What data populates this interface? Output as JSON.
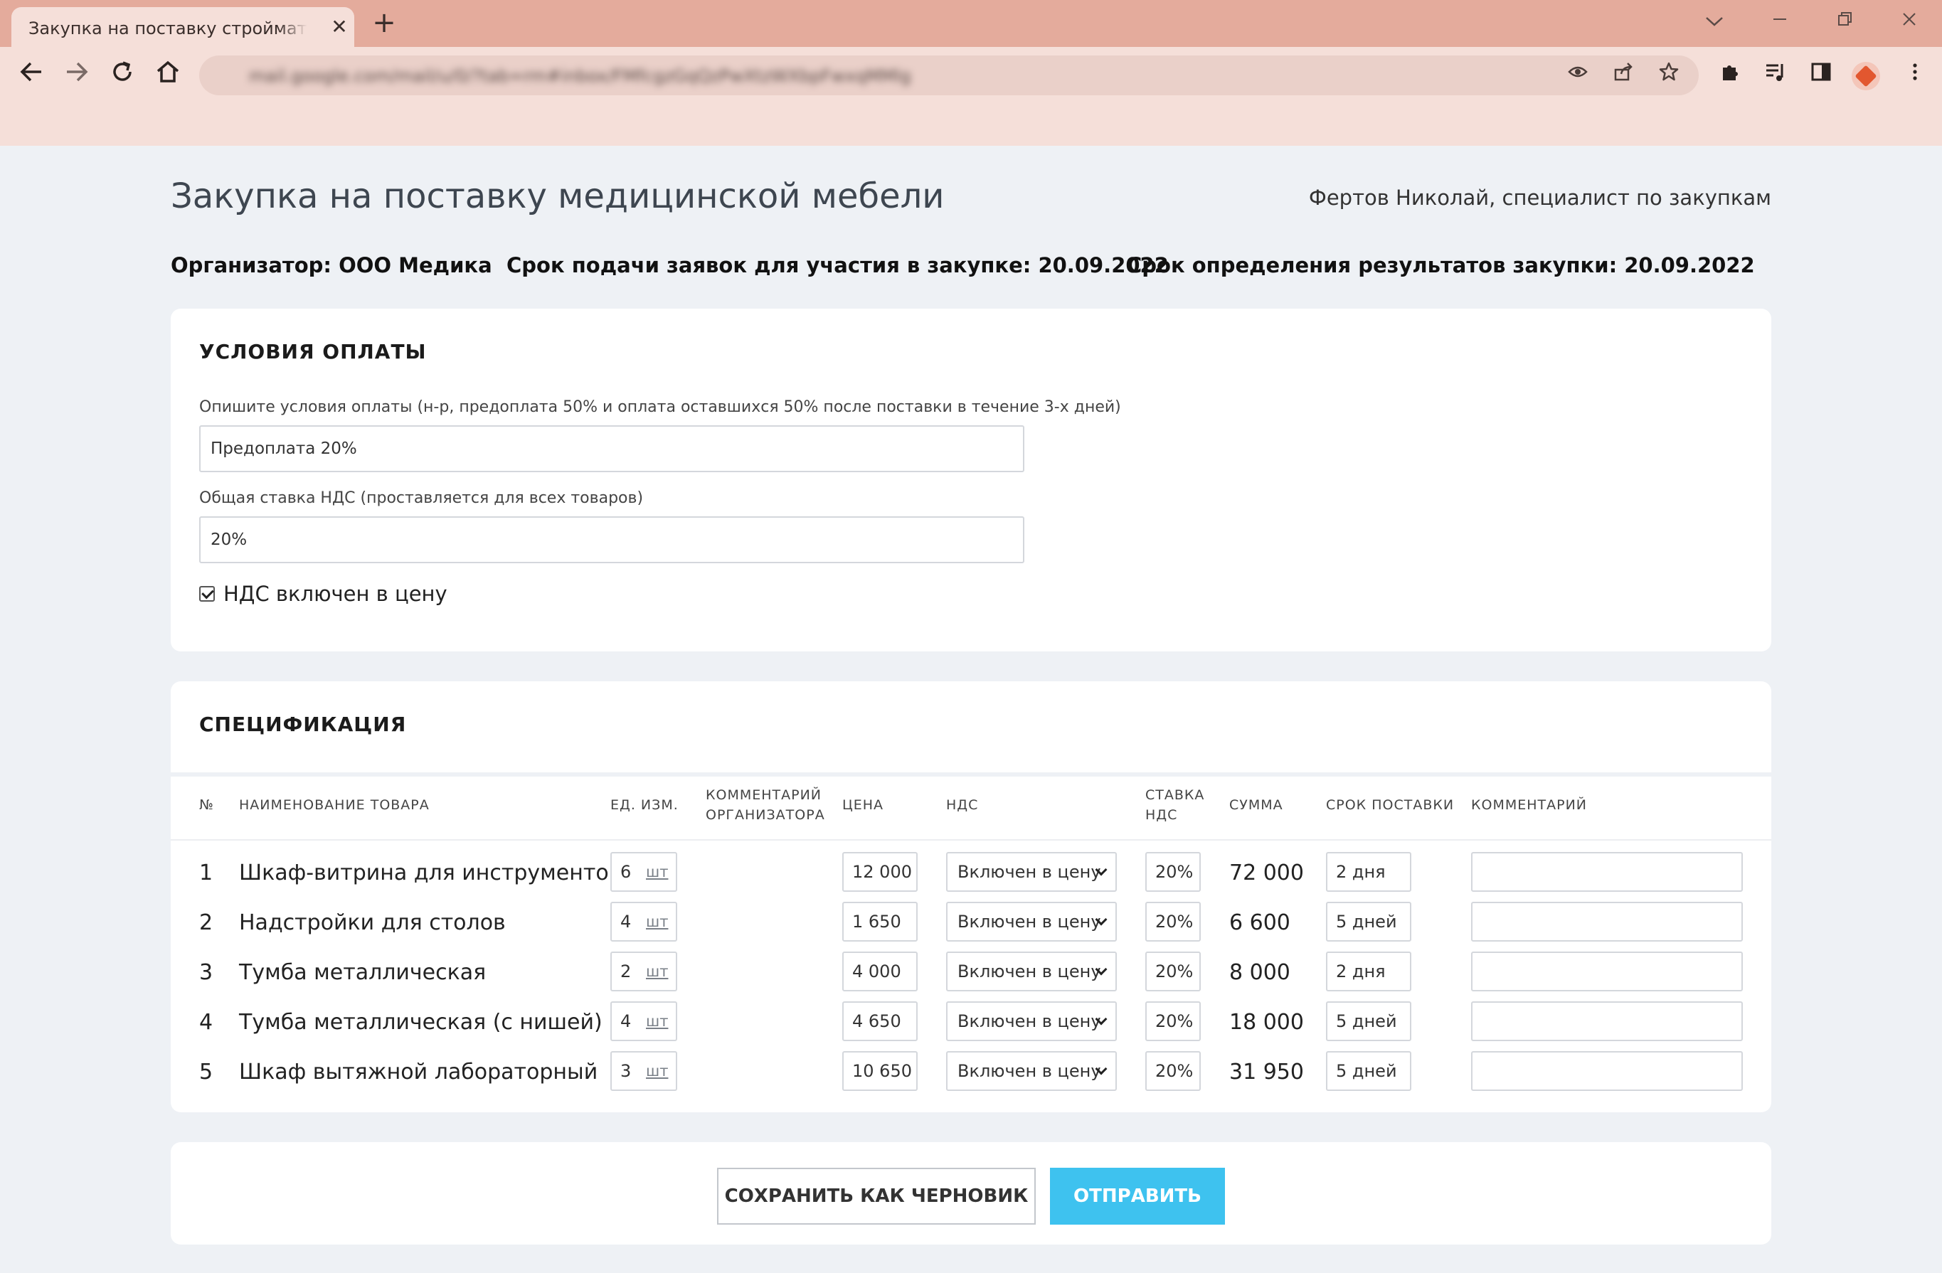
{
  "browser": {
    "tab_title": "Закупка на поставку стройматериалов",
    "tab_close": "✕",
    "new_tab": "+",
    "url": "mail.google.com/mail/u/0/?tab=rm#inbox/FMfcgzGqQzPwXtzWXbpFwxqMMlg"
  },
  "page": {
    "title": "Закупка на поставку медицинской мебели",
    "user": "Фертов Николай, специалист по закупкам",
    "organizer": "Организатор: ООО Медика",
    "apply_deadline": "Срок подачи заявок для участия в закупке: 20.09.2022",
    "results_deadline": "Срок определения результатов закупки: 20.09.2022"
  },
  "payment": {
    "title": "УСЛОВИЯ ОПЛАТЫ",
    "terms_label": "Опишите условия оплаты (н-р, предоплата 50% и оплата оставшихся 50% после поставки в течение 3-х дней)",
    "terms_value": "Предоплата 20%",
    "vat_label": "Общая ставка НДС (проставляется для всех товаров)",
    "vat_value": "20%",
    "vat_included_label": "НДС включен в цену",
    "vat_included_checked": true
  },
  "spec": {
    "title": "СПЕЦИФИКАЦИЯ",
    "headers": {
      "num": "№",
      "name": "НАИМЕНОВАНИЕ ТОВАРА",
      "unit": "ЕД. ИЗМ.",
      "org_comment_1": "КОММЕНТАРИЙ",
      "org_comment_2": "ОРГАНИЗАТОРА",
      "price": "ЦЕНА",
      "vat": "НДС",
      "rate_1": "СТАВКА",
      "rate_2": "НДС",
      "sum": "СУММА",
      "delivery": "СРОК ПОСТАВКИ",
      "comment": "КОММЕНТАРИЙ"
    },
    "rows": [
      {
        "num": "1",
        "name": "Шкаф-витрина для инструментов",
        "qty": "6",
        "unit": "шт",
        "price": "12 000",
        "vat": "Включен в цену",
        "rate": "20%",
        "sum": "72 000",
        "delivery": "2 дня",
        "comment": ""
      },
      {
        "num": "2",
        "name": "Надстройки для столов",
        "qty": "4",
        "unit": "шт",
        "price": "1 650",
        "vat": "Включен в цену",
        "rate": "20%",
        "sum": "6 600",
        "delivery": "5 дней",
        "comment": ""
      },
      {
        "num": "3",
        "name": "Тумба металлическая",
        "qty": "2",
        "unit": "шт",
        "price": "4 000",
        "vat": "Включен в цену",
        "rate": "20%",
        "sum": "8 000",
        "delivery": "2 дня",
        "comment": ""
      },
      {
        "num": "4",
        "name": "Тумба металлическая (с нишей)",
        "qty": "4",
        "unit": "шт",
        "price": "4 650",
        "vat": "Включен в цену",
        "rate": "20%",
        "sum": "18 000",
        "delivery": "5 дней",
        "comment": ""
      },
      {
        "num": "5",
        "name": "Шкаф вытяжной лабораторный",
        "qty": "3",
        "unit": "шт",
        "price": "10 650",
        "vat": "Включен в цену",
        "rate": "20%",
        "sum": "31 950",
        "delivery": "5 дней",
        "comment": ""
      }
    ]
  },
  "actions": {
    "save_draft": "СОХРАНИТЬ КАК ЧЕРНОВИК",
    "submit": "ОТПРАВИТЬ"
  },
  "colors": {
    "tabstrip": "#e4ab9c",
    "toolbar": "#f5dfd9",
    "page_bg": "#eef1f5",
    "primary": "#3ec2ef"
  }
}
